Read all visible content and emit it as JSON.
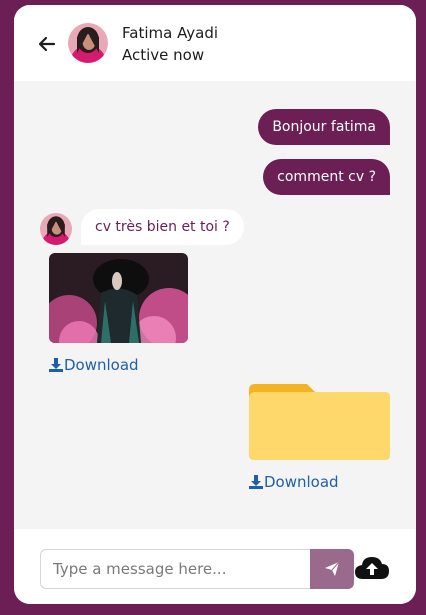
{
  "header": {
    "name": "Fatima Ayadi",
    "status": "Active now",
    "back_icon": "arrow-left-icon"
  },
  "messages": {
    "out_1": "Bonjour fatima",
    "out_2": "comment cv ?",
    "in_1": "cv très bien et toi ?",
    "download_1": "Download",
    "download_2": "Download"
  },
  "composer": {
    "placeholder": "Type a message here...",
    "send_icon": "paper-plane-icon",
    "upload_icon": "cloud-upload-icon"
  },
  "colors": {
    "brand": "#6b1f55",
    "link": "#1f5fa8",
    "folder": "#ffd86b",
    "send": "#9a6a8c"
  }
}
